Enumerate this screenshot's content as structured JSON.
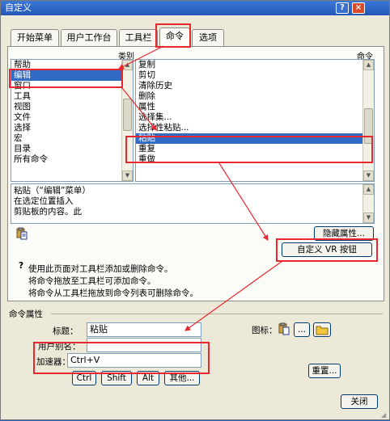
{
  "window": {
    "title": "自定义",
    "help": "?",
    "close": "×"
  },
  "tabs": [
    {
      "label": "开始菜单"
    },
    {
      "label": "用户工作台"
    },
    {
      "label": "工具栏"
    },
    {
      "label": "命令"
    },
    {
      "label": "选项"
    }
  ],
  "headers": {
    "category": "类别",
    "command": "命令"
  },
  "categories": [
    "帮助",
    "编辑",
    "窗口",
    "工具",
    "视图",
    "文件",
    "选择",
    "宏",
    "目录",
    "所有命令"
  ],
  "commands": [
    "复制",
    "剪切",
    "清除历史",
    "删除",
    "属性",
    "选择集...",
    "选择性粘贴...",
    "粘贴",
    "重复",
    "重做"
  ],
  "description": {
    "lines": [
      "粘贴（“编辑”菜单）",
      "在选定位置插入",
      "剪贴板的内容。此"
    ]
  },
  "buttons": {
    "hide_props": "隐藏属性...",
    "custom_vr": "自定义 VR 按钮",
    "ctrl": "Ctrl",
    "shift": "Shift",
    "alt": "Alt",
    "other": "其他...",
    "reset": "重置...",
    "close": "关闭",
    "icon_more": "..."
  },
  "help_text": {
    "line1": "使用此页面对工具栏添加或删除命令。",
    "line2": "将命令拖放至工具栏可添加命令。",
    "line3": "将命令从工具栏拖放到命令列表可删除命令。"
  },
  "props": {
    "section": "命令属性",
    "title_label": "标题：",
    "title_value": "粘贴",
    "alias_label": "用户别名：",
    "alias_value": "",
    "accel_label": "加速器：",
    "accel_value": "Ctrl+V",
    "icon_label": "图标："
  },
  "colors": {
    "selection": "#316ac5",
    "annotation": "#e8282e",
    "titlebar": "#2457b6"
  }
}
